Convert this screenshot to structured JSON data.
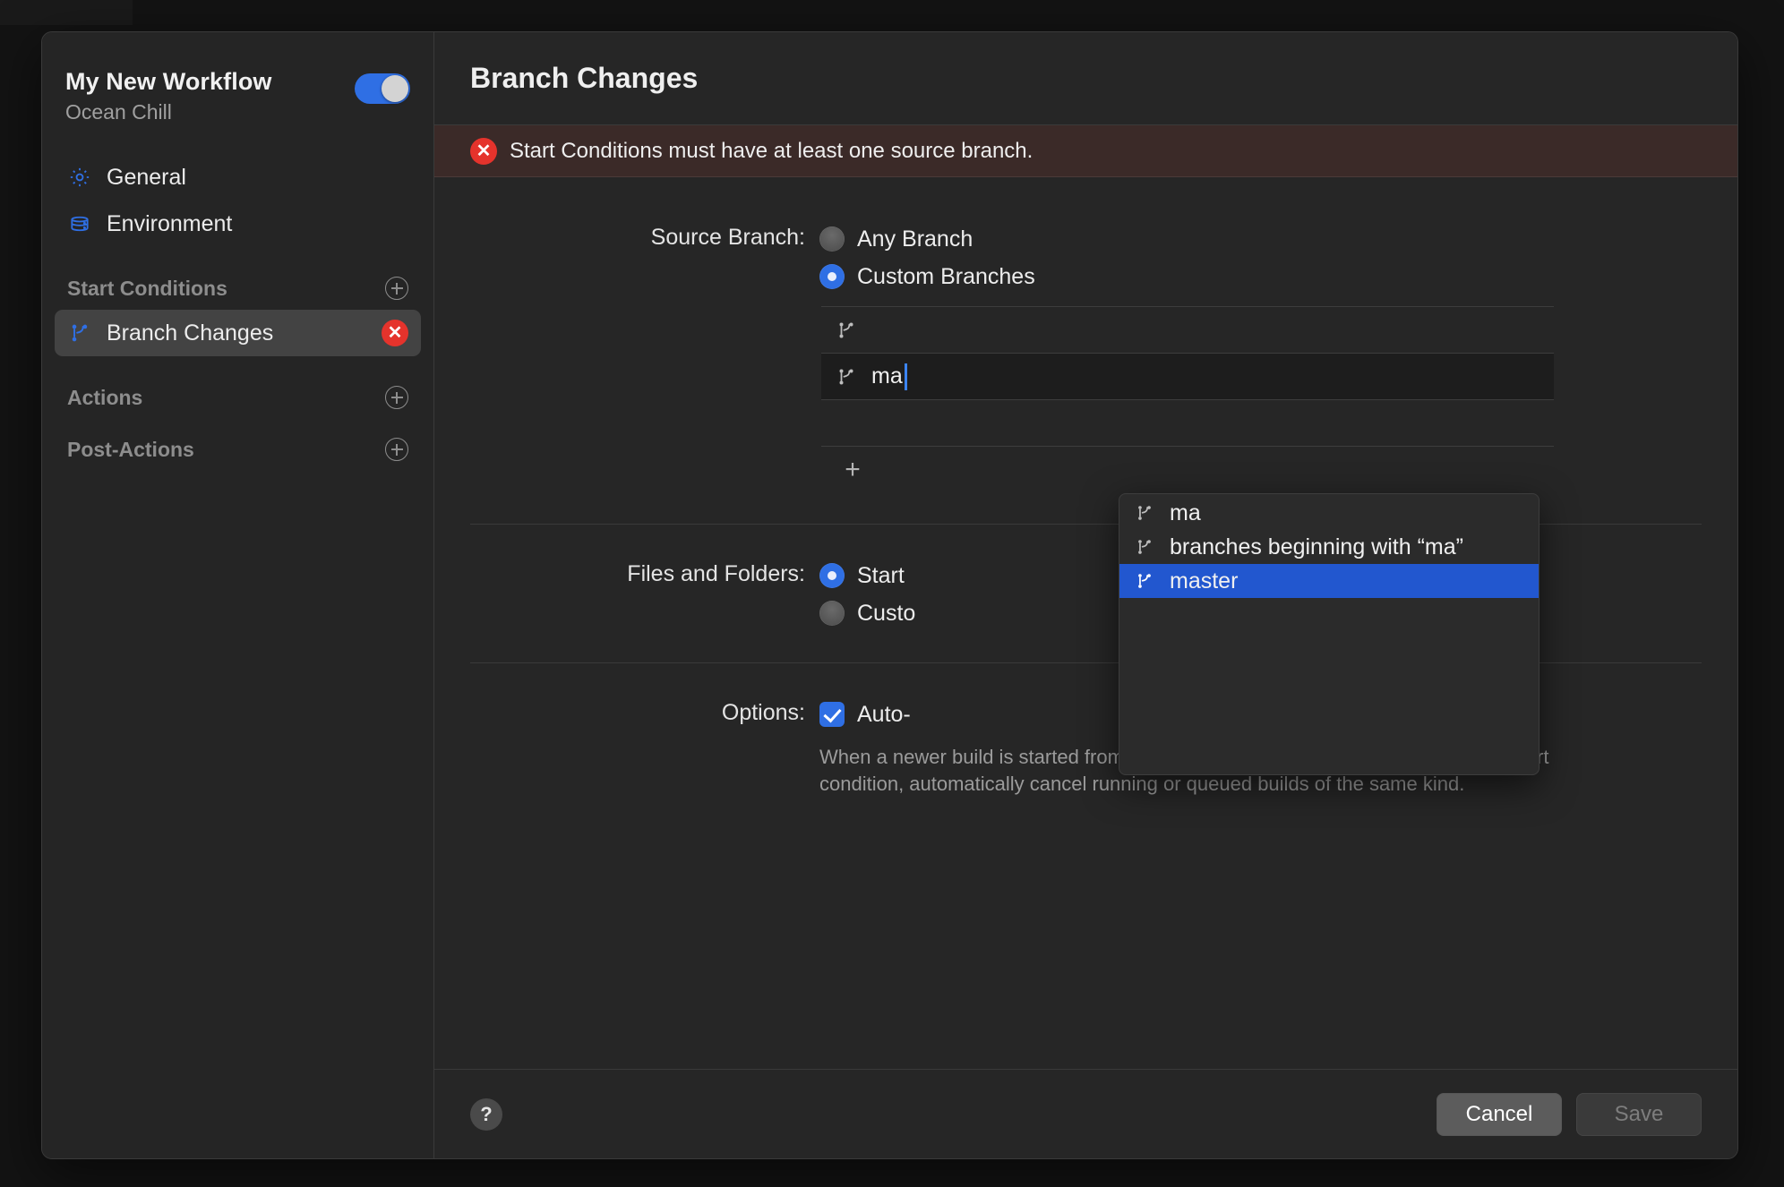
{
  "sidebar": {
    "workflow_title": "My New Workflow",
    "workflow_subtitle": "Ocean Chill",
    "enabled_toggle": "on",
    "nav_items": [
      {
        "label": "General",
        "icon": "gear-icon"
      },
      {
        "label": "Environment",
        "icon": "server-icon"
      }
    ],
    "groups": [
      {
        "title": "Start Conditions",
        "add_label": "+",
        "items": [
          {
            "label": "Branch Changes",
            "icon": "branch-icon",
            "status": "error",
            "status_glyph": "✕"
          }
        ]
      },
      {
        "title": "Actions",
        "add_label": "+",
        "items": []
      },
      {
        "title": "Post-Actions",
        "add_label": "+",
        "items": []
      }
    ]
  },
  "header": {
    "title": "Branch Changes"
  },
  "error_banner": {
    "glyph": "✕",
    "message": "Start Conditions must have at least one source branch."
  },
  "form": {
    "source_branch": {
      "label": "Source Branch:",
      "options": [
        {
          "label": "Any Branch",
          "selected": false
        },
        {
          "label": "Custom Branches",
          "selected": true
        }
      ],
      "branch_rows": [
        {
          "value": "",
          "editing": false
        },
        {
          "value": "ma",
          "editing": true
        }
      ],
      "add_row_label": "+"
    },
    "files_and_folders": {
      "label": "Files and Folders:",
      "options": [
        {
          "label": "Start",
          "selected": true
        },
        {
          "label": "Custo",
          "selected": false
        }
      ]
    },
    "options": {
      "label": "Options:",
      "checkbox_label": "Auto-",
      "checked": true,
      "description": "When a newer build is started from a code push on the same branch using this start condition, automatically cancel running or queued builds of the same kind."
    }
  },
  "autocomplete": {
    "items": [
      {
        "label": "ma",
        "selected": false
      },
      {
        "label": "branches beginning with “ma”",
        "selected": false
      },
      {
        "label": "master",
        "selected": true
      }
    ]
  },
  "footer": {
    "help_label": "?",
    "cancel_label": "Cancel",
    "save_label": "Save"
  },
  "colors": {
    "accent": "#2f6fe4",
    "error": "#e5332c",
    "selection": "#2257cf",
    "banner_bg": "#3b2a28"
  }
}
